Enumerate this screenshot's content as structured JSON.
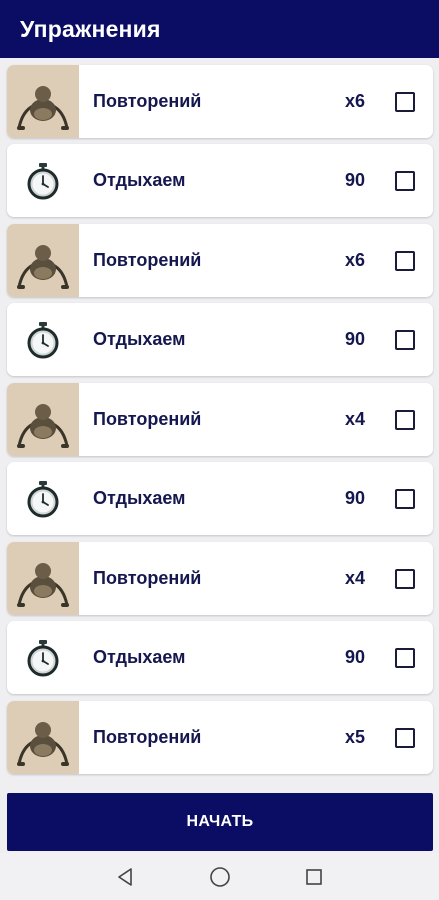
{
  "header": {
    "title": "Упражнения"
  },
  "exercises": [
    {
      "type": "exercise",
      "label": "Повторений",
      "value": "x6",
      "icon": "pushup-image",
      "checked": false
    },
    {
      "type": "rest",
      "label": "Отдыхаем",
      "value": "90",
      "icon": "stopwatch-icon",
      "checked": false
    },
    {
      "type": "exercise",
      "label": "Повторений",
      "value": "x6",
      "icon": "pushup-image",
      "checked": false
    },
    {
      "type": "rest",
      "label": "Отдыхаем",
      "value": "90",
      "icon": "stopwatch-icon",
      "checked": false
    },
    {
      "type": "exercise",
      "label": "Повторений",
      "value": "x4",
      "icon": "pushup-image",
      "checked": false
    },
    {
      "type": "rest",
      "label": "Отдыхаем",
      "value": "90",
      "icon": "stopwatch-icon",
      "checked": false
    },
    {
      "type": "exercise",
      "label": "Повторений",
      "value": "x4",
      "icon": "pushup-image",
      "checked": false
    },
    {
      "type": "rest",
      "label": "Отдыхаем",
      "value": "90",
      "icon": "stopwatch-icon",
      "checked": false
    },
    {
      "type": "exercise",
      "label": "Повторений",
      "value": "x5",
      "icon": "pushup-image",
      "checked": false
    }
  ],
  "start_button": {
    "label": "НАЧАТЬ"
  },
  "navbar": {
    "icons": [
      "back-icon",
      "home-icon",
      "recents-icon"
    ]
  },
  "colors": {
    "primary": "#0b0c63",
    "text": "#15174f",
    "thumb_bg": "#ddcdb6",
    "background": "#efeff1"
  }
}
